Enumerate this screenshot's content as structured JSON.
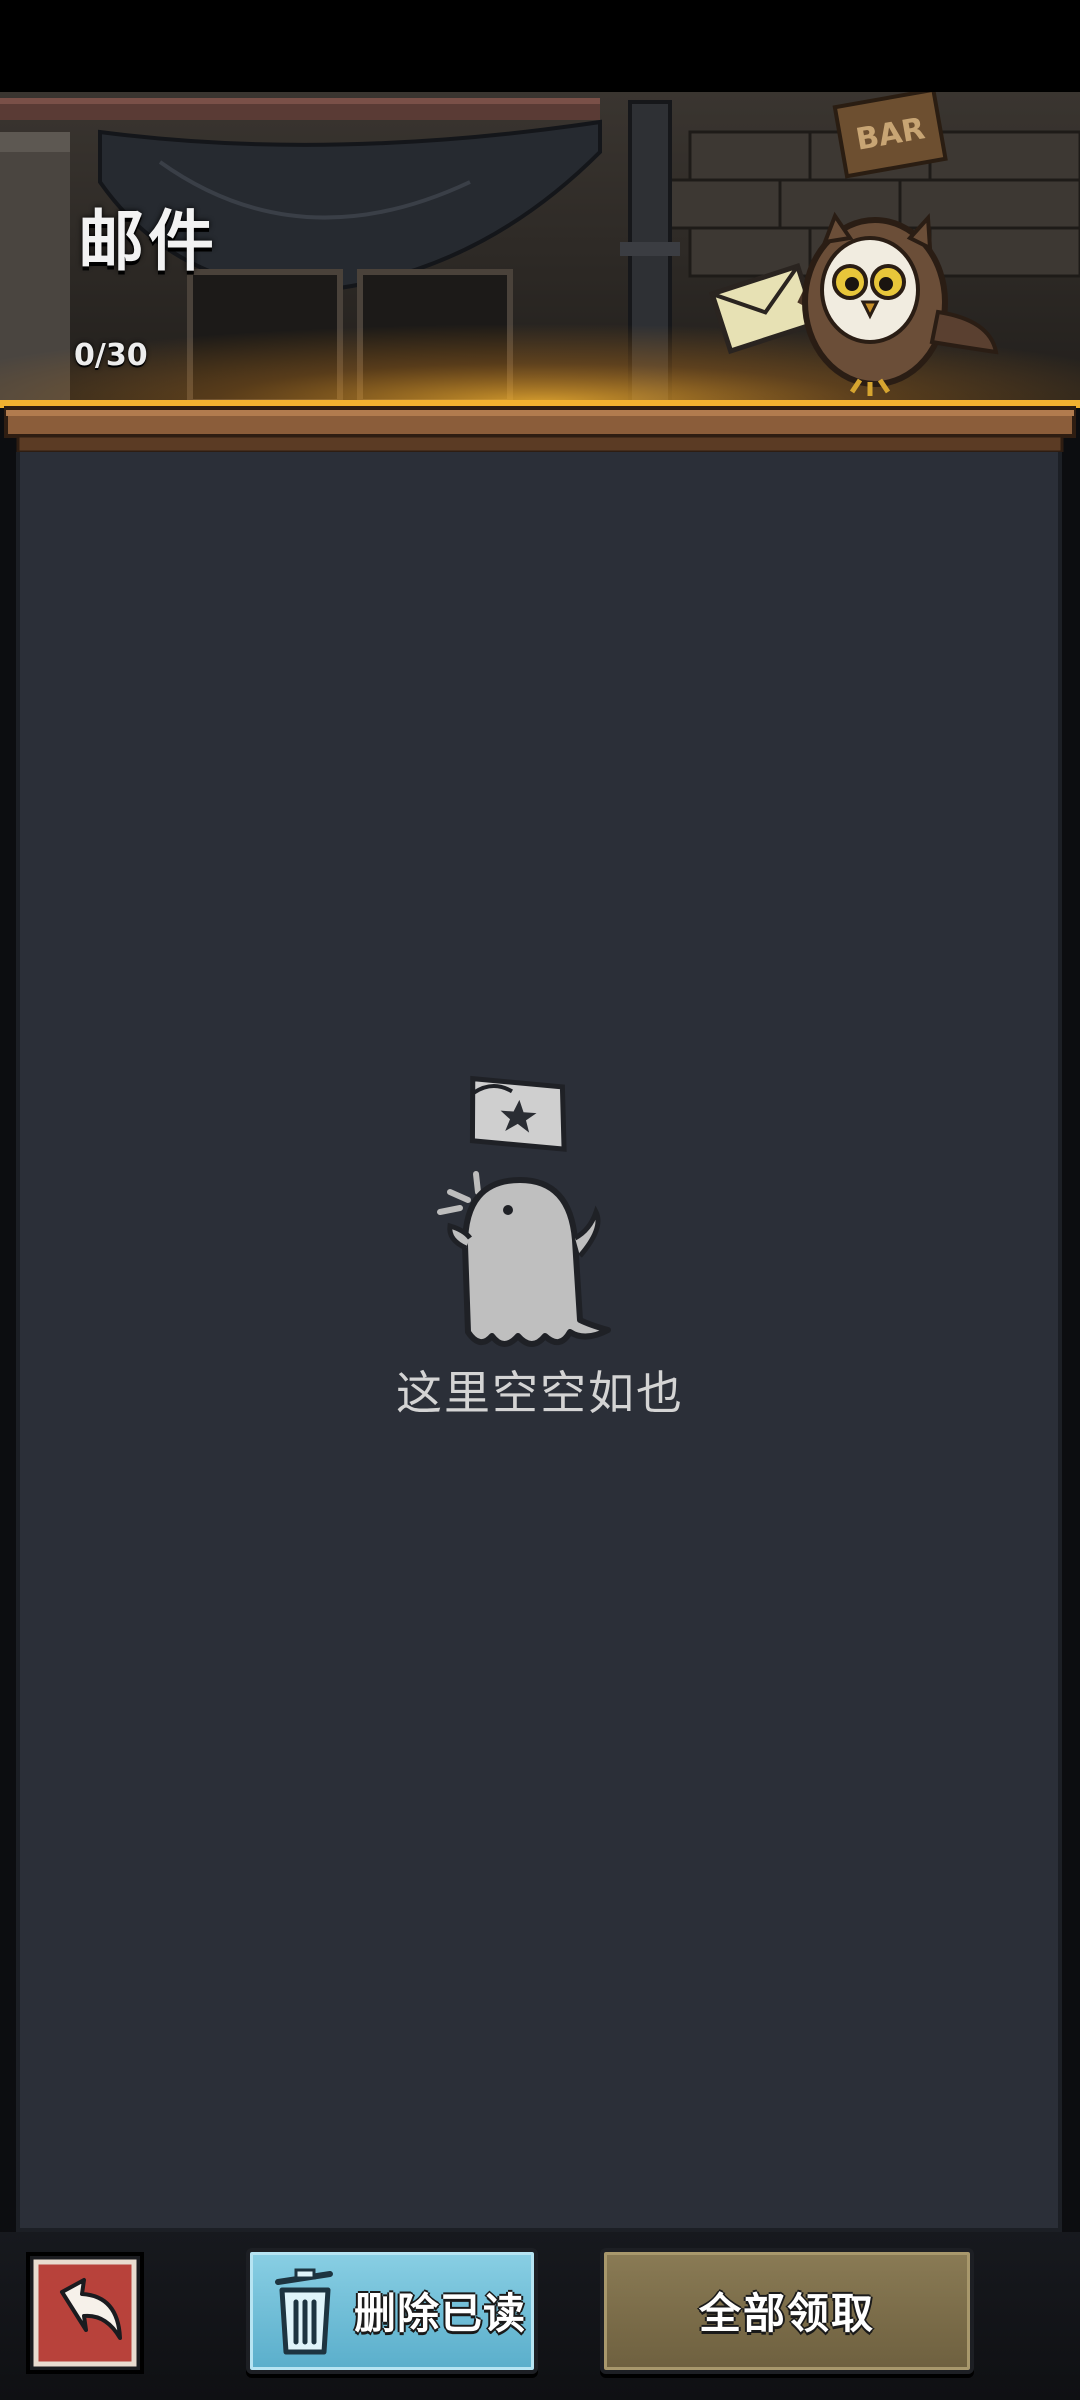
{
  "header": {
    "title": "邮件",
    "mail_count": "0/30",
    "sign_text": "BAR"
  },
  "empty_state": {
    "message": "这里空空如也"
  },
  "bottom_bar": {
    "delete_read_label": "删除已读",
    "claim_all_label": "全部领取"
  },
  "colors": {
    "panel": "#2b2f38",
    "delete_button": "#6fc0d8",
    "claim_button": "#7c6d4a",
    "back_button": "#b8423b",
    "shelf_glow": "#f2b130"
  },
  "icons": {
    "back": "return-arrow-icon",
    "delete": "trash-icon",
    "mascot": "owl-mail-carrier",
    "empty": "ghost-with-letter"
  }
}
